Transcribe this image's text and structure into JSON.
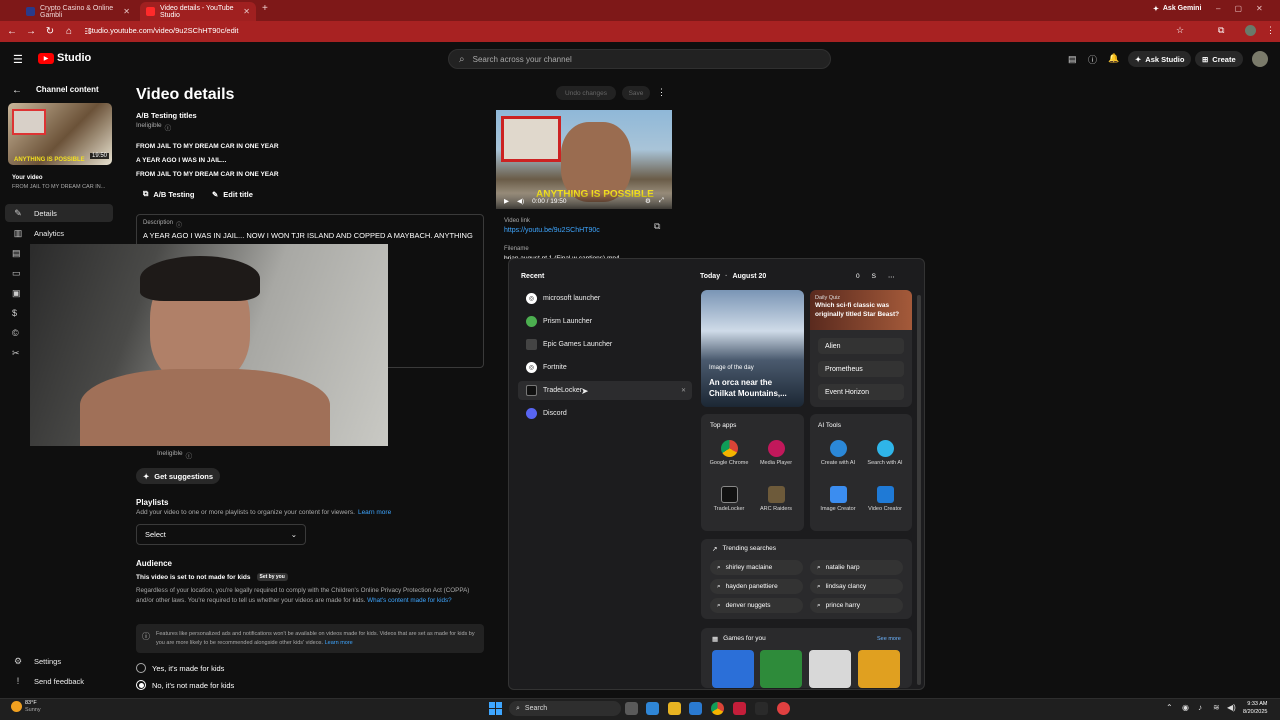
{
  "browser": {
    "tabs": [
      {
        "title": "Crypto Casino & Online Gambli",
        "active": false
      },
      {
        "title": "Video details - YouTube Studio",
        "active": true
      }
    ],
    "profile_label": "Ask Gemini",
    "url": "studio.youtube.com/video/9u2SChHT90c/edit"
  },
  "studio": {
    "logo": "Studio",
    "search_placeholder": "Search across your channel",
    "ask_studio": "Ask Studio",
    "create": "Create"
  },
  "sidebar": {
    "back_label": "Channel content",
    "video_duration": "19:50",
    "your_video": "Your video",
    "video_title": "FROM JAIL TO MY DREAM CAR IN...",
    "items": [
      {
        "label": "Details",
        "icon": "pencil-icon"
      },
      {
        "label": "Analytics",
        "icon": "analytics-icon"
      }
    ],
    "settings": "Settings",
    "feedback": "Send feedback"
  },
  "main": {
    "page_title": "Video details",
    "undo": "Undo changes",
    "save": "Save",
    "ab_heading": "A/B Testing titles",
    "ineligible": "Ineligible",
    "titles": [
      "FROM JAIL TO MY DREAM CAR IN ONE YEAR",
      "A YEAR AGO I WAS IN JAIL...",
      "FROM JAIL TO MY DREAM CAR IN ONE YEAR"
    ],
    "ab_button": "A/B Testing",
    "edit_button": "Edit title",
    "description_label": "Description",
    "description_text": "A YEAR AGO I WAS IN JAIL... NOW I WON TJR ISLAND AND COPPED A MAYBACH. ANYTHING IN THIS LIFE IS POSSIBLE!!",
    "ineligible2": "Ineligible",
    "suggestions": "Get suggestions",
    "playlists_heading": "Playlists",
    "playlists_desc": "Add your video to one or more playlists to organize your content for viewers.",
    "learn_more": "Learn more",
    "select": "Select",
    "audience_heading": "Audience",
    "audience_status": "This video is set to not made for kids",
    "set_by_you": "Set by you",
    "audience_desc": "Regardless of your location, you're legally required to comply with the Children's Online Privacy Protection Act (COPPA) and/or other laws. You're required to tell us whether your videos are made for kids.",
    "whats_content": "What's content made for kids?",
    "info_text": "Features like personalized ads and notifications won't be available on videos made for kids. Videos that are set as made for kids by you are more likely to be recommended alongside other kids' videos.",
    "radio_yes": "Yes, it's made for kids",
    "radio_no": "No, it's not made for kids"
  },
  "player": {
    "time": "0:00 / 19:50",
    "video_link_label": "Video link",
    "video_link": "https://youtu.be/9u2SChHT90c",
    "filename_label": "Filename",
    "filename": "brian august pt 1 (Final w captions).mp4",
    "overlay_text": "ANYTHING IS POSSIBLE"
  },
  "start_menu": {
    "recent_label": "Recent",
    "recent": [
      {
        "label": "microsoft launcher",
        "color": "#ffffff"
      },
      {
        "label": "Prism Launcher",
        "color": "#4caf50"
      },
      {
        "label": "Epic Games Launcher",
        "color": "#444444"
      },
      {
        "label": "Fortnite",
        "color": "#ffffff"
      },
      {
        "label": "TradeLocker",
        "color": "#111111"
      },
      {
        "label": "Discord",
        "color": "#5865f2"
      }
    ],
    "today": "Today",
    "date": "August 20",
    "points": "0",
    "avatar": "S",
    "image_of_day_label": "Image of the day",
    "image_of_day_title": "An orca near the Chilkat Mountains,...",
    "quiz_label": "Daily Quiz",
    "quiz_question": "Which sci-fi classic was originally titled Star Beast?",
    "quiz_answers": [
      "Alien",
      "Prometheus",
      "Event Horizon"
    ],
    "top_apps_label": "Top apps",
    "top_apps": [
      {
        "label": "Google Chrome",
        "color": "#db4437"
      },
      {
        "label": "Media Player",
        "color": "#c2185b"
      },
      {
        "label": "TradeLocker",
        "color": "#111111"
      },
      {
        "label": "ARC Raiders",
        "color": "#6d5a3a"
      }
    ],
    "ai_tools_label": "AI Tools",
    "ai_tools": [
      {
        "label": "Create with AI",
        "color": "#2b88d8"
      },
      {
        "label": "Search with AI",
        "color": "#2fb5e9"
      },
      {
        "label": "Image Creator",
        "color": "#3b8df0"
      },
      {
        "label": "Video Creator",
        "color": "#1f7ad6"
      }
    ],
    "trending_label": "Trending searches",
    "trending": [
      "shirley maclaine",
      "natalie harp",
      "hayden panettiere",
      "lindsay clancy",
      "denver nuggets",
      "prince harry"
    ],
    "games_label": "Games for you",
    "see_more": "See more"
  },
  "taskbar": {
    "weather_temp": "83°F",
    "weather_cond": "Sunny",
    "search_placeholder": "Search",
    "time": "9:33 AM",
    "date": "8/20/2025"
  }
}
